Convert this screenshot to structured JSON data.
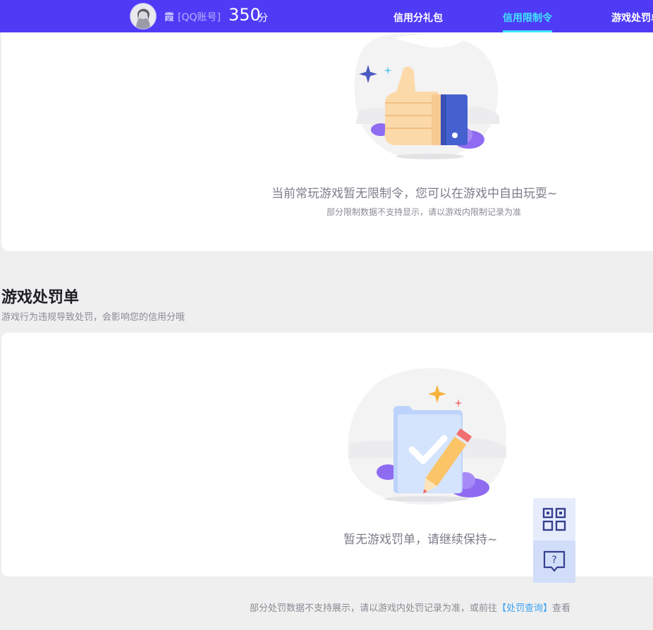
{
  "header": {
    "user_name": "霞",
    "account_label": "[QQ账号]",
    "score": "350",
    "score_unit": "分",
    "nav": [
      {
        "label": "信用分礼包",
        "active": false
      },
      {
        "label": "信用限制令",
        "active": true
      },
      {
        "label": "游戏处罚单",
        "active": false
      }
    ],
    "accent_color": "#4f3bf6",
    "active_color": "#40e4ff"
  },
  "restriction_card": {
    "empty_title": "当前常玩游戏暂无限制令，您可以在游戏中自由玩耍~",
    "empty_subtitle": "部分限制数据不支持显示，请以游戏内限制记录为准",
    "illustration_icon": "thumbs-up-icon"
  },
  "penalty_section": {
    "title": "游戏处罚单",
    "subtitle": "游戏行为违规导致处罚，会影响您的信用分哦",
    "empty_title": "暂无游戏罚单，请继续保持~",
    "illustration_icon": "clipboard-pencil-icon"
  },
  "floating_buttons": [
    {
      "icon": "qr-code-icon"
    },
    {
      "icon": "help-chat-icon",
      "glyph": "?"
    }
  ],
  "footer": {
    "text_before": "部分处罚数据不支持展示，请以游戏内处罚记录为准，或前往",
    "link_text": "【处罚查询】",
    "text_after": "查看"
  }
}
